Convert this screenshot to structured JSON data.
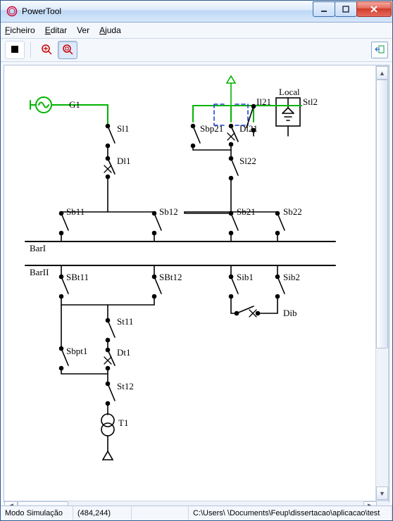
{
  "app": {
    "title": "PowerTool"
  },
  "menu": {
    "file": "Ficheiro",
    "edit": "Editar",
    "view": "Ver",
    "help": "Ajuda"
  },
  "status": {
    "mode": "Modo Simulação",
    "coords": "(484,244)",
    "path": "C:\\Users\\     \\Documents\\Feup\\dissertacao\\aplicacao\\test"
  },
  "icons": {
    "stop": "stop-icon",
    "zoom_in": "zoom-in-icon",
    "zoom_fit": "zoom-fit-icon",
    "dock": "dock-panel-icon"
  },
  "labels": {
    "G1": "G1",
    "Sl1": "Sl1",
    "Dl1": "Dl1",
    "Sb11": "Sb11",
    "Sb12": "Sb12",
    "Sb21": "Sb21",
    "Sb22": "Sb22",
    "BarI": "BarI",
    "BarII": "BarII",
    "SBt11": "SBt11",
    "SBt12": "SBt12",
    "St11": "St11",
    "Sbpt1": "Sbpt1",
    "Dt1": "Dt1",
    "St12": "St12",
    "T1": "T1",
    "Il21": "Il21",
    "Stl2": "Stl2",
    "Local": "Local",
    "Sbp21": "Sbp21",
    "Dl21": "Dl21",
    "Sl22": "Sl22",
    "Sib1": "Sib1",
    "Sib2": "Sib2",
    "Dib": "Dib"
  },
  "colors": {
    "accent": "#00b400",
    "dashed": "#2040e0"
  }
}
